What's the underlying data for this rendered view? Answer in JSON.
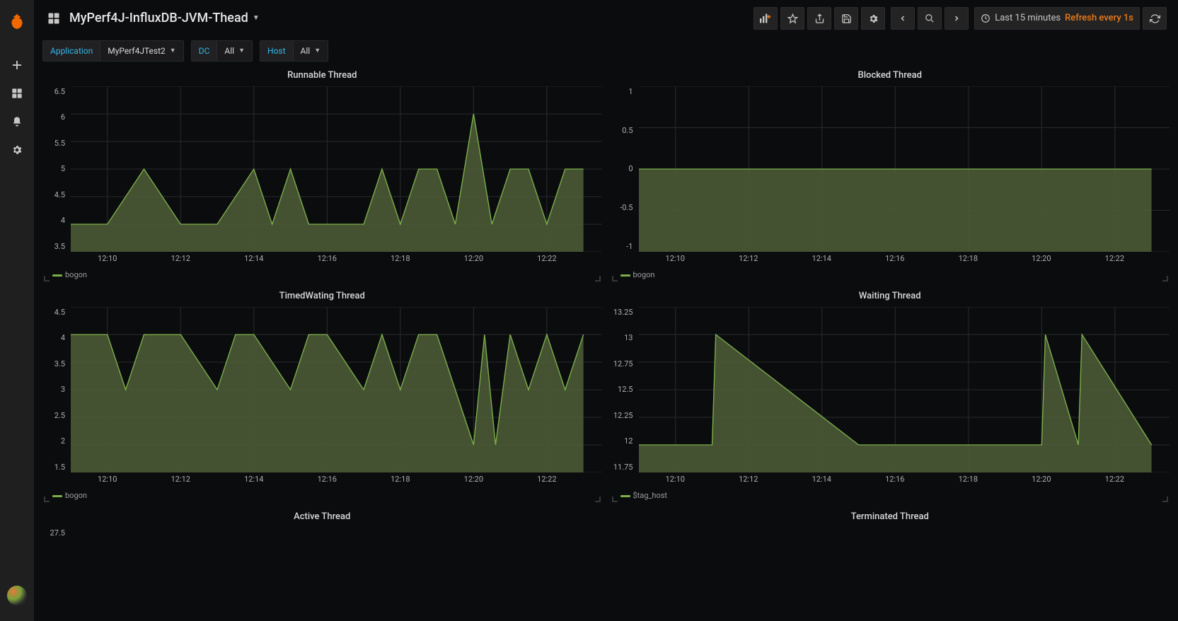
{
  "header": {
    "title": "MyPerf4J-InfluxDB-JVM-Thead",
    "time_range": "Last 15 minutes",
    "refresh": "Refresh every 1s"
  },
  "variables": [
    {
      "label": "Application",
      "value": "MyPerf4JTest2"
    },
    {
      "label": "DC",
      "value": "All"
    },
    {
      "label": "Host",
      "value": "All"
    }
  ],
  "xticks": [
    "12:10",
    "12:12",
    "12:14",
    "12:16",
    "12:18",
    "12:20",
    "12:22"
  ],
  "chart_data": [
    {
      "id": "runnable",
      "title": "Runnable Thread",
      "type": "line",
      "xlabel": "",
      "ylabel": "",
      "ylim": [
        3.5,
        6.5
      ],
      "yticks": [
        3.5,
        4.0,
        4.5,
        5.0,
        5.5,
        6.0,
        6.5
      ],
      "legend": "bogon",
      "x": [
        "12:09",
        "12:10",
        "12:11",
        "12:12",
        "12:13",
        "12:14",
        "12:14.5",
        "12:15",
        "12:15.5",
        "12:16",
        "12:17",
        "12:17.5",
        "12:18",
        "12:18.5",
        "12:19",
        "12:19.5",
        "12:20",
        "12:20.5",
        "12:21",
        "12:21.5",
        "12:22",
        "12:22.5",
        "12:23"
      ],
      "series": [
        {
          "name": "bogon",
          "values": [
            4,
            4,
            5,
            4,
            4,
            5,
            4,
            5,
            4,
            4,
            4,
            5,
            4,
            5,
            5,
            4,
            6,
            4,
            5,
            5,
            4,
            5,
            5
          ]
        }
      ]
    },
    {
      "id": "blocked",
      "title": "Blocked Thread",
      "type": "line",
      "xlabel": "",
      "ylabel": "",
      "ylim": [
        -1.0,
        1.0
      ],
      "yticks": [
        -1.0,
        -0.5,
        0,
        0.5,
        1.0
      ],
      "legend": "bogon",
      "x": [
        "12:09",
        "12:23"
      ],
      "series": [
        {
          "name": "bogon",
          "values": [
            0,
            0
          ]
        }
      ]
    },
    {
      "id": "timedwaiting",
      "title": "TimedWating Thread",
      "type": "line",
      "xlabel": "",
      "ylabel": "",
      "ylim": [
        1.5,
        4.5
      ],
      "yticks": [
        1.5,
        2.0,
        2.5,
        3.0,
        3.5,
        4.0,
        4.5
      ],
      "legend": "bogon",
      "x": [
        "12:09",
        "12:10",
        "12:10.5",
        "12:11",
        "12:12",
        "12:13",
        "12:13.5",
        "12:14",
        "12:15",
        "12:15.5",
        "12:16",
        "12:17",
        "12:17.5",
        "12:18",
        "12:18.5",
        "12:19",
        "12:19.5",
        "12:20",
        "12:20.3",
        "12:20.6",
        "12:21",
        "12:21.5",
        "12:22",
        "12:22.5",
        "12:23"
      ],
      "series": [
        {
          "name": "bogon",
          "values": [
            4,
            4,
            3,
            4,
            4,
            3,
            4,
            4,
            3,
            4,
            4,
            3,
            4,
            3,
            4,
            4,
            3,
            2,
            4,
            2,
            4,
            3,
            4,
            3,
            4
          ]
        }
      ]
    },
    {
      "id": "waiting",
      "title": "Waiting Thread",
      "type": "line",
      "xlabel": "",
      "ylabel": "",
      "ylim": [
        11.75,
        13.25
      ],
      "yticks": [
        11.75,
        12.0,
        12.25,
        12.5,
        12.75,
        13.0,
        13.25
      ],
      "legend": "$tag_host",
      "x": [
        "12:09",
        "12:11",
        "12:11.1",
        "12:15",
        "12:20",
        "12:20.1",
        "12:21",
        "12:21.1",
        "12:23"
      ],
      "series": [
        {
          "name": "$tag_host",
          "values": [
            12,
            12,
            13,
            12,
            12,
            13,
            12,
            13,
            12
          ]
        }
      ]
    },
    {
      "id": "active",
      "title": "Active Thread",
      "type": "line",
      "ylim": [
        27,
        28
      ],
      "yticks": [
        27.5
      ],
      "legend": "",
      "series": []
    },
    {
      "id": "terminated",
      "title": "Terminated Thread",
      "type": "line",
      "ylim": [
        0,
        1
      ],
      "yticks": [],
      "legend": "",
      "series": []
    }
  ]
}
